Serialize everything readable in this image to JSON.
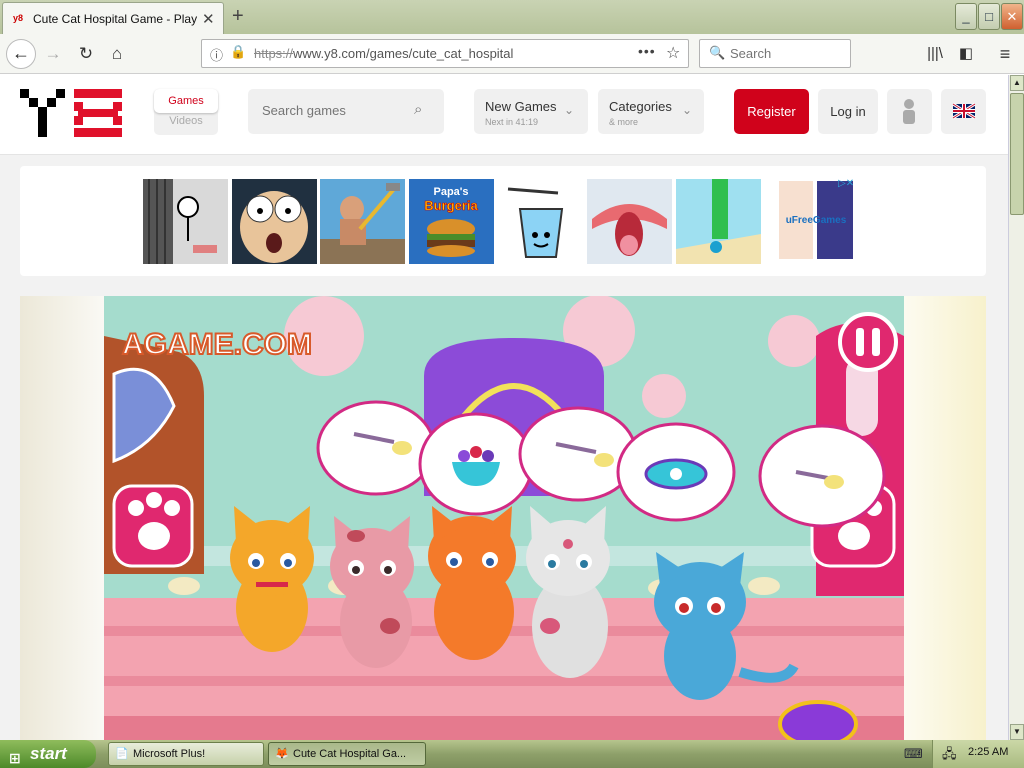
{
  "browser": {
    "tab_title": "Cute Cat Hospital Game - Play online",
    "tab_favicon": "y8",
    "url_scheme": "https://",
    "url_rest": "www.y8.com/games/cute_cat_hospital",
    "search_placeholder": "Search",
    "window_buttons": [
      "_",
      "□",
      "✕"
    ]
  },
  "site": {
    "logo": "Y8",
    "nav": {
      "games": "Games",
      "videos": "Videos"
    },
    "search_placeholder": "Search games",
    "new_games": {
      "title": "New Games",
      "subtitle": "Next in 41:19"
    },
    "categories": {
      "title": "Categories",
      "subtitle": "& more"
    },
    "register": "Register",
    "login": "Log in"
  },
  "ads": {
    "thumbnails": [
      "stickman-prison-thumbnail",
      "scared-face-thumbnail",
      "climber-hammer-thumbnail",
      "papas-burgeria-thumbnail",
      "happy-glass-thumbnail",
      "tongue-thumbnail",
      "stack-run-thumbnail"
    ],
    "papas_line1": "Papa's",
    "papas_line2": "Burgeria",
    "ufree": "uFreeGames"
  },
  "game": {
    "brand": "AGAME.COM",
    "bubbles": [
      "tweezers",
      "candy-bowl",
      "tweezers",
      "bandage-roll",
      "tweezers"
    ],
    "cats": [
      "orange",
      "pink-spotted",
      "orange-striped",
      "white-spotted",
      "blue-striped"
    ]
  },
  "taskbar": {
    "start": "start",
    "items": [
      "Microsoft Plus!",
      "Cute Cat Hospital Ga..."
    ],
    "clock": "2:25 AM"
  },
  "colors": {
    "brand_red": "#d0021b",
    "game_pink": "#e0286f",
    "xp_green": "#8ea06a"
  }
}
